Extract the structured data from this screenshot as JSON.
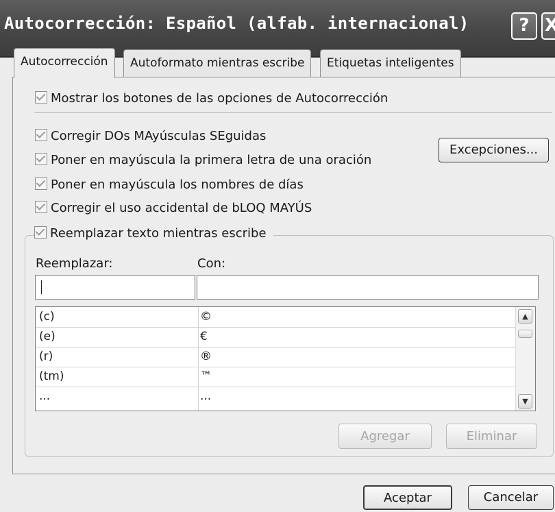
{
  "window": {
    "title": "Autocorrección: Español (alfab. internacional)",
    "help_label": "?",
    "close_label": "X"
  },
  "tabs": [
    {
      "label": "Autocorrección",
      "active": true
    },
    {
      "label": "Autoformato mientras escribe",
      "active": false
    },
    {
      "label": "Etiquetas inteligentes",
      "active": false
    }
  ],
  "options": {
    "show_buttons": {
      "label": "Mostrar los botones de las opciones de Autocorrección",
      "checked": true
    },
    "two_initial_caps": {
      "label": "Corregir DOs MAyúsculas SEguidas",
      "checked": true
    },
    "capitalize_sentences": {
      "label": "Poner en mayúscula la primera letra de una oración",
      "checked": true
    },
    "capitalize_days": {
      "label": "Poner en mayúscula los nombres de días",
      "checked": true
    },
    "caps_lock": {
      "label": "Corregir el uso accidental de bLOQ MAYÚS",
      "checked": true
    },
    "replace_text": {
      "label": "Reemplazar texto mientras escribe",
      "checked": true
    }
  },
  "exceptions_label": "Excepciones...",
  "replace": {
    "replace_label": "Reemplazar:",
    "with_label": "Con:",
    "replace_value": "",
    "with_value": "",
    "rows": [
      {
        "from": "(c)",
        "to": "©"
      },
      {
        "from": "(e)",
        "to": "€"
      },
      {
        "from": "(r)",
        "to": "®"
      },
      {
        "from": "(tm)",
        "to": "™"
      },
      {
        "from": "...",
        "to": "..."
      }
    ],
    "add_label": "Agregar",
    "delete_label": "Eliminar"
  },
  "footer": {
    "ok_label": "Aceptar",
    "cancel_label": "Cancelar"
  },
  "colors": {
    "titlebar": "#474747",
    "dialog_bg": "#ececec",
    "disabled_text": "#a6a6a6"
  },
  "icons": {
    "scroll_up": "chevron-up-icon",
    "scroll_down": "chevron-down-icon",
    "check": "check-icon"
  }
}
